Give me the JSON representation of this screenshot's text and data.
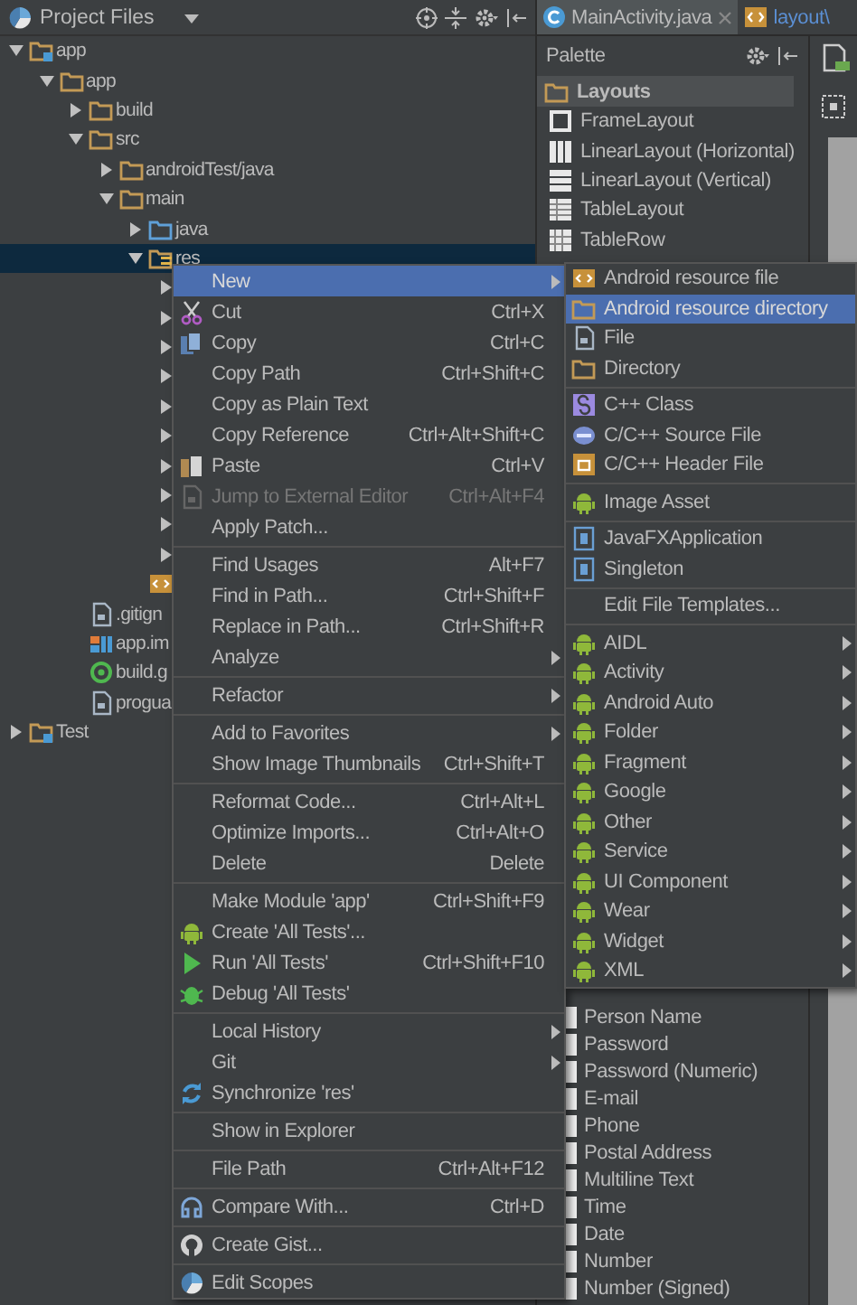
{
  "project_panel": {
    "title": "Project Files",
    "tree": [
      {
        "name": "app",
        "kind": "module",
        "expanded": true,
        "selected": false,
        "children": [
          {
            "name": "app",
            "kind": "folder",
            "expanded": true,
            "selected": false,
            "children": [
              {
                "name": "build",
                "kind": "folder",
                "expanded": false,
                "selected": false
              },
              {
                "name": "src",
                "kind": "folder",
                "expanded": true,
                "selected": false,
                "children": [
                  {
                    "name": "androidTest/java",
                    "kind": "folder",
                    "expanded": false,
                    "selected": false
                  },
                  {
                    "name": "main",
                    "kind": "folder",
                    "expanded": true,
                    "selected": false,
                    "children": [
                      {
                        "name": "java",
                        "kind": "source-folder",
                        "expanded": false,
                        "selected": false
                      },
                      {
                        "name": "res",
                        "kind": "res-folder",
                        "expanded": true,
                        "selected": true,
                        "children": [
                          {
                            "expanded": false
                          },
                          {
                            "expanded": false
                          },
                          {
                            "expanded": false
                          },
                          {
                            "expanded": false
                          },
                          {
                            "expanded": false
                          },
                          {
                            "expanded": false
                          },
                          {
                            "expanded": false
                          },
                          {
                            "expanded": false
                          },
                          {
                            "expanded": false
                          },
                          {
                            "expanded": false
                          }
                        ]
                      },
                      {
                        "kind": "layout-file"
                      }
                    ]
                  }
                ]
              },
              {
                "name": ".gitign",
                "kind": "file",
                "selected": false
              },
              {
                "name": "app.im",
                "kind": "module-file",
                "selected": false
              },
              {
                "name": "build.g",
                "kind": "gradle-file",
                "selected": false
              },
              {
                "name": "progua",
                "kind": "file",
                "selected": false
              }
            ]
          }
        ]
      },
      {
        "name": "Test",
        "kind": "module",
        "expanded": false,
        "selected": false
      }
    ]
  },
  "editor_tabs": [
    {
      "label": "MainActivity.java",
      "kind": "class",
      "selected": true,
      "closable": true
    },
    {
      "label": "layout\\",
      "kind": "layout",
      "selected": false
    }
  ],
  "palette": {
    "title": "Palette",
    "group": "Layouts",
    "items": [
      {
        "label": "FrameLayout",
        "kind": "frame"
      },
      {
        "label": "LinearLayout (Horizontal)",
        "kind": "columns"
      },
      {
        "label": "LinearLayout (Vertical)",
        "kind": "rows"
      },
      {
        "label": "TableLayout",
        "kind": "table"
      },
      {
        "label": "TableRow",
        "kind": "table-row"
      }
    ],
    "lower_items": [
      {
        "label": "Person Name",
        "kind": "text-field"
      },
      {
        "label": "Password",
        "kind": "text-field"
      },
      {
        "label": "Password (Numeric)",
        "kind": "text-field"
      },
      {
        "label": "E-mail",
        "kind": "text-field"
      },
      {
        "label": "Phone",
        "kind": "text-field"
      },
      {
        "label": "Postal Address",
        "kind": "text-field"
      },
      {
        "label": "Multiline Text",
        "kind": "text-field"
      },
      {
        "label": "Time",
        "kind": "text-field"
      },
      {
        "label": "Date",
        "kind": "text-field"
      },
      {
        "label": "Number",
        "kind": "text-field"
      },
      {
        "label": "Number (Signed)",
        "kind": "text-field"
      }
    ]
  },
  "context_menu": {
    "groups": [
      [
        {
          "label": "New",
          "selected": true,
          "disabled": false,
          "submenu": true
        },
        {
          "label": "Cut",
          "shortcut": "Ctrl+X",
          "kind": "cut",
          "selected": false,
          "disabled": false,
          "submenu": false
        },
        {
          "label": "Copy",
          "shortcut": "Ctrl+C",
          "kind": "copy",
          "selected": false,
          "disabled": false,
          "submenu": false
        },
        {
          "label": "Copy Path",
          "shortcut": "Ctrl+Shift+C",
          "selected": false,
          "disabled": false,
          "submenu": false
        },
        {
          "label": "Copy as Plain Text",
          "selected": false,
          "disabled": false,
          "submenu": false
        },
        {
          "label": "Copy Reference",
          "shortcut": "Ctrl+Alt+Shift+C",
          "selected": false,
          "disabled": false,
          "submenu": false
        },
        {
          "label": "Paste",
          "shortcut": "Ctrl+V",
          "kind": "paste",
          "selected": false,
          "disabled": false,
          "submenu": false
        },
        {
          "label": "Jump to External Editor",
          "shortcut": "Ctrl+Alt+F4",
          "kind": "document",
          "selected": false,
          "disabled": true,
          "submenu": false
        },
        {
          "label": "Apply Patch...",
          "selected": false,
          "disabled": false,
          "submenu": false
        }
      ],
      [
        {
          "label": "Find Usages",
          "shortcut": "Alt+F7",
          "selected": false,
          "disabled": false,
          "submenu": false
        },
        {
          "label": "Find in Path...",
          "shortcut": "Ctrl+Shift+F",
          "selected": false,
          "disabled": false,
          "submenu": false
        },
        {
          "label": "Replace in Path...",
          "shortcut": "Ctrl+Shift+R",
          "selected": false,
          "disabled": false,
          "submenu": false
        },
        {
          "label": "Analyze",
          "selected": false,
          "disabled": false,
          "submenu": true
        }
      ],
      [
        {
          "label": "Refactor",
          "selected": false,
          "disabled": false,
          "submenu": true
        }
      ],
      [
        {
          "label": "Add to Favorites",
          "selected": false,
          "disabled": false,
          "submenu": true
        },
        {
          "label": "Show Image Thumbnails",
          "shortcut": "Ctrl+Shift+T",
          "selected": false,
          "disabled": false,
          "submenu": false
        }
      ],
      [
        {
          "label": "Reformat Code...",
          "shortcut": "Ctrl+Alt+L",
          "selected": false,
          "disabled": false,
          "submenu": false
        },
        {
          "label": "Optimize Imports...",
          "shortcut": "Ctrl+Alt+O",
          "selected": false,
          "disabled": false,
          "submenu": false
        },
        {
          "label": "Delete",
          "shortcut": "Delete",
          "selected": false,
          "disabled": false,
          "submenu": false
        }
      ],
      [
        {
          "label": "Make Module 'app'",
          "shortcut": "Ctrl+Shift+F9",
          "selected": false,
          "disabled": false,
          "submenu": false
        },
        {
          "label": "Create 'All Tests'...",
          "kind": "android",
          "selected": false,
          "disabled": false,
          "submenu": false
        },
        {
          "label": "Run 'All Tests'",
          "shortcut": "Ctrl+Shift+F10",
          "kind": "run",
          "selected": false,
          "disabled": false,
          "submenu": false
        },
        {
          "label": "Debug 'All Tests'",
          "kind": "debug",
          "selected": false,
          "disabled": false,
          "submenu": false
        }
      ],
      [
        {
          "label": "Local History",
          "selected": false,
          "disabled": false,
          "submenu": true
        },
        {
          "label": "Git",
          "selected": false,
          "disabled": false,
          "submenu": true
        },
        {
          "label": "Synchronize 'res'",
          "kind": "sync",
          "selected": false,
          "disabled": false,
          "submenu": false
        }
      ],
      [
        {
          "label": "Show in Explorer",
          "selected": false,
          "disabled": false,
          "submenu": false
        }
      ],
      [
        {
          "label": "File Path",
          "shortcut": "Ctrl+Alt+F12",
          "selected": false,
          "disabled": false,
          "submenu": false
        }
      ],
      [
        {
          "label": "Compare With...",
          "shortcut": "Ctrl+D",
          "kind": "compare",
          "selected": false,
          "disabled": false,
          "submenu": false
        }
      ],
      [
        {
          "label": "Create Gist...",
          "kind": "gist",
          "selected": false,
          "disabled": false,
          "submenu": false
        }
      ],
      [
        {
          "label": "Edit Scopes",
          "kind": "scopes",
          "selected": false,
          "disabled": false,
          "submenu": false
        }
      ]
    ]
  },
  "submenu": {
    "groups": [
      [
        {
          "label": "Android resource file",
          "kind": "resource-file",
          "selected": false,
          "submenu": false
        },
        {
          "label": "Android resource directory",
          "kind": "folder",
          "selected": true,
          "submenu": false
        },
        {
          "label": "File",
          "kind": "file",
          "selected": false,
          "submenu": false
        },
        {
          "label": "Directory",
          "kind": "folder",
          "selected": false,
          "submenu": false
        }
      ],
      [
        {
          "label": "C++ Class",
          "kind": "cpp-class",
          "selected": false,
          "submenu": false
        },
        {
          "label": "C/C++ Source File",
          "kind": "cpp-source",
          "selected": false,
          "submenu": false
        },
        {
          "label": "C/C++ Header File",
          "kind": "cpp-header",
          "selected": false,
          "submenu": false
        }
      ],
      [
        {
          "label": "Image Asset",
          "kind": "android",
          "selected": false,
          "submenu": false
        }
      ],
      [
        {
          "label": "JavaFXApplication",
          "kind": "java-file",
          "selected": false,
          "submenu": false
        },
        {
          "label": "Singleton",
          "kind": "java-file",
          "selected": false,
          "submenu": false
        }
      ],
      [
        {
          "label": "Edit File Templates...",
          "selected": false,
          "submenu": false
        }
      ],
      [
        {
          "label": "AIDL",
          "kind": "android",
          "selected": false,
          "submenu": true
        },
        {
          "label": "Activity",
          "kind": "android",
          "selected": false,
          "submenu": true
        },
        {
          "label": "Android Auto",
          "kind": "android",
          "selected": false,
          "submenu": true
        },
        {
          "label": "Folder",
          "kind": "android",
          "selected": false,
          "submenu": true
        },
        {
          "label": "Fragment",
          "kind": "android",
          "selected": false,
          "submenu": true
        },
        {
          "label": "Google",
          "kind": "android",
          "selected": false,
          "submenu": true
        },
        {
          "label": "Other",
          "kind": "android",
          "selected": false,
          "submenu": true
        },
        {
          "label": "Service",
          "kind": "android",
          "selected": false,
          "submenu": true
        },
        {
          "label": "UI Component",
          "kind": "android",
          "selected": false,
          "submenu": true
        },
        {
          "label": "Wear",
          "kind": "android",
          "selected": false,
          "submenu": true
        },
        {
          "label": "Widget",
          "kind": "android",
          "selected": false,
          "submenu": true
        },
        {
          "label": "XML",
          "kind": "android",
          "selected": false,
          "submenu": true
        }
      ]
    ]
  }
}
